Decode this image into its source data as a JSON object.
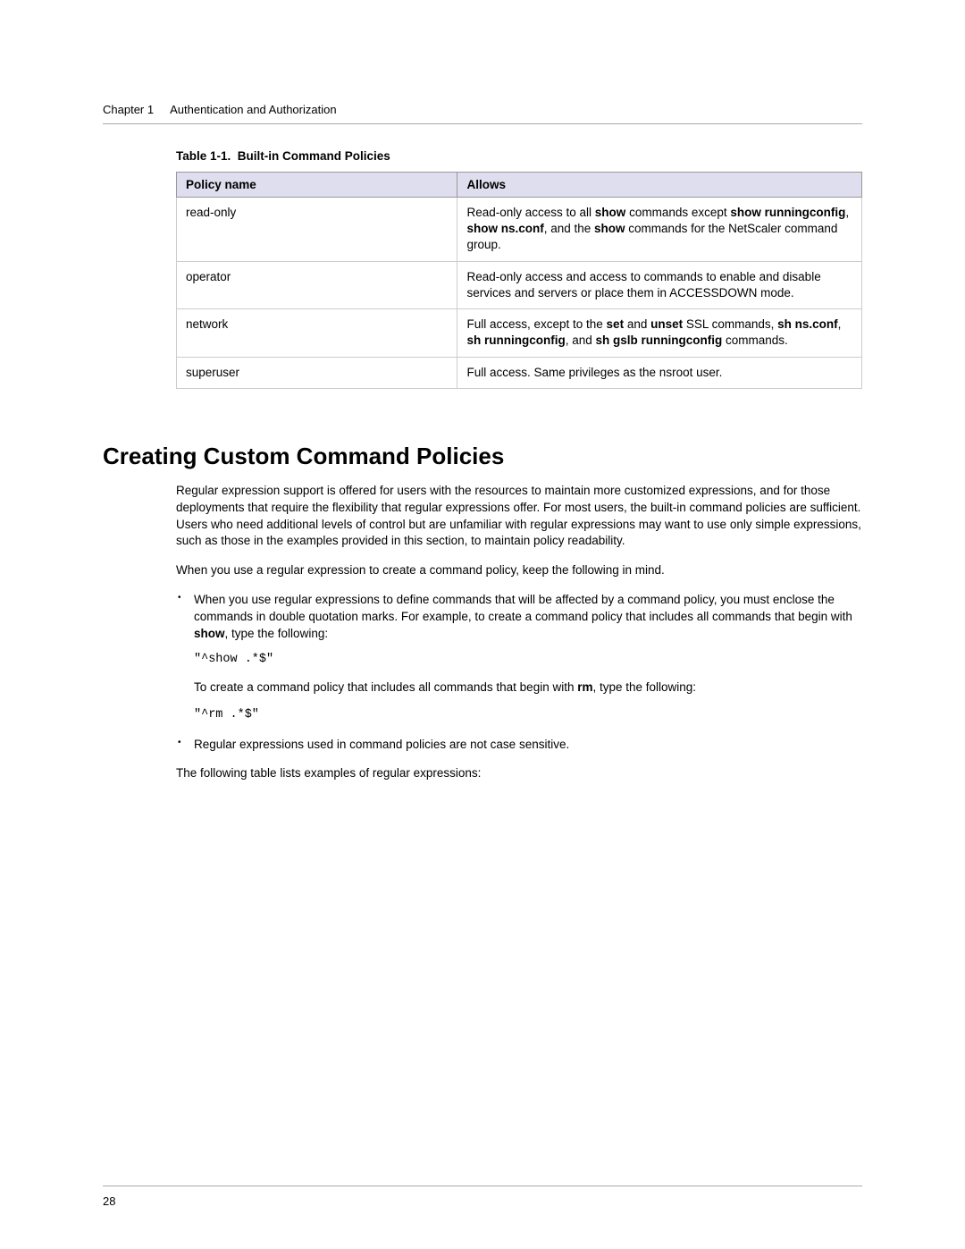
{
  "header": {
    "chapter": "Chapter 1",
    "title": "Authentication and Authorization"
  },
  "table": {
    "caption_label": "Table 1-1.",
    "caption_title": "Built-in Command Policies",
    "col1": "Policy name",
    "col2": "Allows",
    "rows": [
      {
        "name": "read-only",
        "t1": "Read-only access to all ",
        "b1": "show",
        "t2": " commands except ",
        "b2": "show runningconfig",
        "t3": ", ",
        "b3": "show ns.conf",
        "t4": ", and the ",
        "b4": "show",
        "t5": " commands for the NetScaler command group."
      },
      {
        "name": "operator",
        "desc": "Read-only access and access to commands to enable and disable services and servers or place them in ACCESSDOWN mode."
      },
      {
        "name": "network",
        "t1": "Full access, except to the ",
        "b1": "set",
        "t2": " and ",
        "b2": "unset",
        "t3": " SSL commands, ",
        "b3": "sh ns.conf",
        "t4": ", ",
        "b4": "sh runningconfig",
        "t5": ", and ",
        "b5": "sh gslb runningconfig",
        "t6": " commands."
      },
      {
        "name": "superuser",
        "desc": "Full access. Same privileges as the nsroot user."
      }
    ]
  },
  "section": {
    "heading": "Creating Custom Command Policies",
    "para1": "Regular expression support is offered for users with the resources to maintain more customized expressions, and for those deployments that require the flexibility that regular expressions offer. For most users, the built-in command policies are sufficient. Users who need additional levels of control but are unfamiliar with regular expressions may want to use only simple expressions, such as those in the examples provided in this section, to maintain policy readability.",
    "para2": "When you use a regular expression to create a command policy, keep the following in mind.",
    "bullets": [
      {
        "t1": "When you use regular expressions to define commands that will be affected by a command policy, you must enclose the commands in double quotation marks. For example, to create a command policy that includes all commands that begin with ",
        "b1": "show",
        "t2": ", type the following:",
        "code1": "\"^show .*$\"",
        "sub_t1": "To create a command policy that includes all commands that begin with ",
        "sub_b1": "rm",
        "sub_t2": ", type the following:",
        "code2": "\"^rm .*$\""
      },
      {
        "text": "Regular expressions used in command policies are not case sensitive."
      }
    ],
    "para3": "The following table lists examples of regular expressions:"
  },
  "page_number": "28"
}
